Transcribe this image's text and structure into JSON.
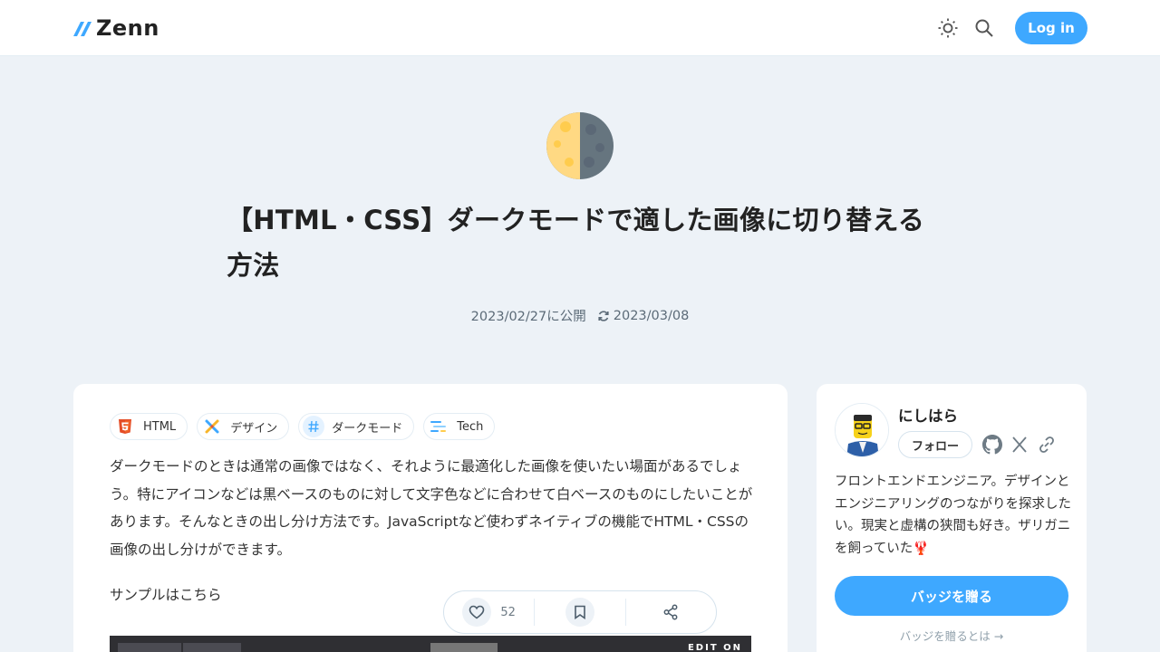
{
  "header": {
    "logo_text": "Zenn",
    "login_label": "Log in",
    "accent_color": "#3ea8ff"
  },
  "article": {
    "emoji": "first-quarter-moon",
    "title": "【HTML・CSS】ダークモードで適した画像に切り替える方法",
    "published": "2023/02/27に公開",
    "updated": "2023/03/08",
    "topics": [
      {
        "label": "HTML",
        "icon": "html5-icon"
      },
      {
        "label": "デザイン",
        "icon": "design-icon"
      },
      {
        "label": "ダークモード",
        "icon": "hash-icon"
      },
      {
        "label": "Tech",
        "icon": "tech-icon"
      }
    ],
    "body": "ダークモードのときは通常の画像ではなく、それように最適化した画像を使いたい場面があるでしょう。特にアイコンなどは黒ベースのものに対して文字色などに合わせて白ベースのものにしたいことがあります。そんなときの出し分け方法です。JavaScriptなど使わずネイティブの機能でHTML・CSSの画像の出し分けができます。",
    "sample_text": "サンプルはこちら",
    "embed_edit_label": "EDIT ON"
  },
  "actions": {
    "like_count": "52"
  },
  "author": {
    "name": "にしはら",
    "follow_label": "フォロー",
    "bio": "フロントエンドエンジニア。デザインとエンジニアリングのつながりを探求したい。現実と虚構の狭間も好き。ザリガニを飼っていた🦞",
    "badge_button": "バッジを贈る",
    "badge_link": "バッジを贈るとは"
  }
}
